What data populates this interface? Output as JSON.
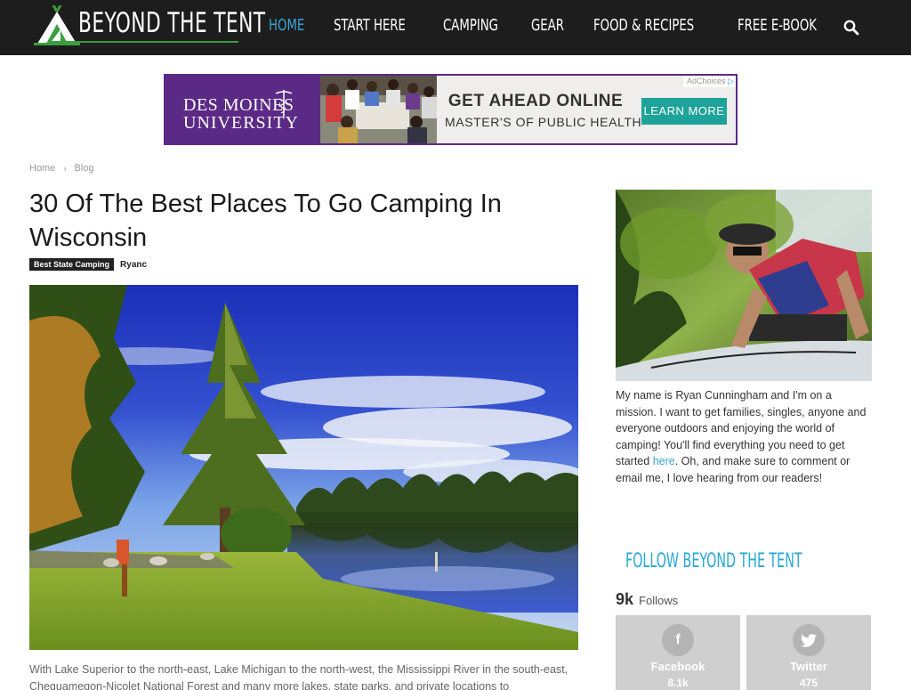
{
  "brand": {
    "logo_text": "BEYOND THE TENT"
  },
  "nav": {
    "items": [
      {
        "label": "HOME",
        "active": true
      },
      {
        "label": "START HERE",
        "active": false
      },
      {
        "label": "CAMPING",
        "active": false
      },
      {
        "label": "GEAR",
        "active": false
      },
      {
        "label": "FOOD & RECIPES",
        "active": false
      },
      {
        "label": "FREE E-BOOK",
        "active": false
      }
    ],
    "search_icon": "search-icon",
    "accent_color": "#3aa3d8"
  },
  "ad": {
    "brand_line1": "DES MOINES",
    "brand_line2": "UNIVERSITY",
    "headline": "GET AHEAD ONLINE",
    "subline": "MASTER'S OF PUBLIC HEALTH",
    "cta": "LEARN MORE",
    "adchoices": "AdChoices",
    "brand_color": "#5b2a86",
    "cta_color": "#1ea39a"
  },
  "breadcrumb": {
    "home": "Home",
    "current": "Blog"
  },
  "article": {
    "title": "30 Of The Best Places To Go Camping In Wisconsin",
    "category": "Best State Camping",
    "author": "Ryanc",
    "excerpt": "With Lake Superior to the north-east, Lake Michigan to the north-west, the Mississippi River in the south-east, Chequamegon-Nicolet National Forest and many more lakes, state parks, and private locations to"
  },
  "sidebar": {
    "bio_text_1": "My name is Ryan Cunningham and I'm on a mission. I want to get families, singles, anyone and everyone outdoors and enjoying the world of camping! You'll find everything you need to get started ",
    "bio_link": "here",
    "bio_text_2": ". Oh, and make sure to comment or email me, I love hearing from our readers!",
    "follow_title": "FOLLOW BEYOND THE TENT",
    "follow_count": "9k",
    "follow_label": "Follows",
    "social": [
      {
        "name": "Facebook",
        "count": "8.1k",
        "icon": "facebook-icon"
      },
      {
        "name": "Twitter",
        "count": "475",
        "icon": "twitter-icon"
      }
    ]
  }
}
